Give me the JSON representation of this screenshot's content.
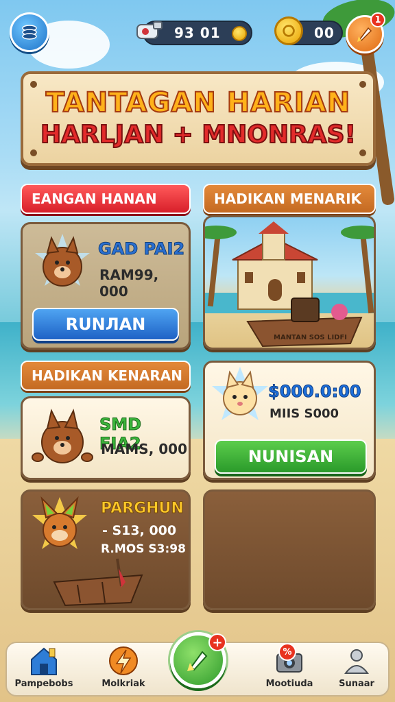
{
  "topbar": {
    "currency_1": "93 01",
    "currency_2": "00",
    "notification_badge": "1"
  },
  "banner": {
    "line1": "TANTAGAN HARIAN",
    "line2": "HARLJAN + MNONRAS!"
  },
  "card_1": {
    "tab_label": "EANGAN HANAN",
    "title": "GAD PAI2",
    "amount": "RAM99, 000",
    "button_label": "RUNЛAN"
  },
  "card_2": {
    "tab_label": "HADIKAN MENARIK",
    "boat_label": "MANTAN SOS LIDFI"
  },
  "card_3": {
    "tab_label": "HADIKAN KENARAN",
    "title": "SMD FIA2",
    "amount": "MAMS, 000"
  },
  "card_4": {
    "title": "$000.0:00",
    "amount": "MIIS S000",
    "button_label": "NUNISAN"
  },
  "card_5": {
    "title": "PARGHUN",
    "line1": "- S13, 000",
    "line2": "R.MOS S3:98"
  },
  "bottom_nav": {
    "items": [
      {
        "label": "Pampebobs",
        "icon": "home-icon"
      },
      {
        "label": "Molkriak",
        "icon": "lightning-icon"
      },
      {
        "label": "",
        "icon": "rocket-icon"
      },
      {
        "label": "Mootiuda",
        "icon": "camera-icon",
        "badge": "%"
      },
      {
        "label": "Sunaar",
        "icon": "person-icon"
      }
    ]
  },
  "colors": {
    "banner_text_1": "#ffb21a",
    "banner_text_2": "#e32b2b",
    "tab_red": "#d81f2a",
    "tab_brown": "#c46a22",
    "button_blue": "#1e62c6",
    "button_green": "#2a9a2a"
  }
}
